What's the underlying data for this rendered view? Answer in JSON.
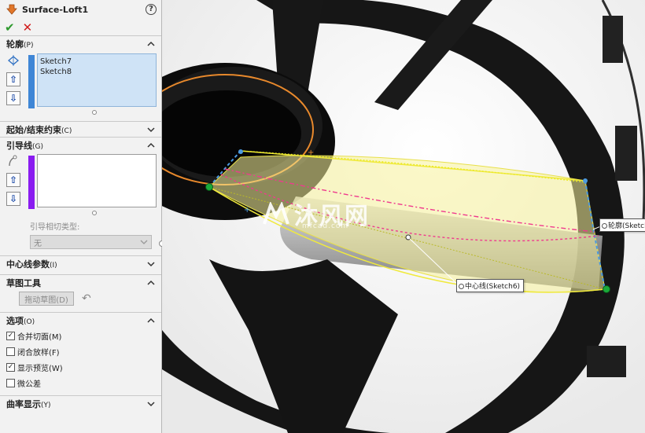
{
  "feature": {
    "title": "Surface-Loft1",
    "help": "?"
  },
  "actions": {
    "ok": "✔",
    "cancel": "✕"
  },
  "sections": {
    "profiles": {
      "title": "轮廓",
      "mnemonic": "(P)",
      "items": [
        "Sketch7",
        "Sketch8"
      ]
    },
    "start_end": {
      "title": "起始/结束约束",
      "mnemonic": "(C)"
    },
    "guides": {
      "title": "引导线",
      "mnemonic": "(G)",
      "items": [],
      "tangency_label": "引导相切类型:",
      "tangency_value": "无"
    },
    "centerline": {
      "title": "中心线参数",
      "mnemonic": "(I)"
    },
    "sketch_tools": {
      "title": "草图工具",
      "drag_button": "拖动草图(D)"
    },
    "options": {
      "title": "选项",
      "mnemonic": "(O)",
      "checks": [
        {
          "label": "合并切面(M)",
          "checked": true
        },
        {
          "label": "闭合放样(F)",
          "checked": false
        },
        {
          "label": "显示预览(W)",
          "checked": true
        },
        {
          "label": "微公差",
          "checked": false
        }
      ]
    },
    "curvature": {
      "title": "曲率显示",
      "mnemonic": "(Y)"
    }
  },
  "viewport": {
    "callout_centerline": "中心线(Sketch6)",
    "callout_profile": "轮廓(Sketch",
    "watermark": "沐风网",
    "watermark_url": "mfcad.com"
  },
  "colors": {
    "profile_bar": "#3f86d6",
    "guide_bar": "#8a1cf0",
    "list_selected": "#cfe3f6",
    "loft_surface": "#f7f29a",
    "model": "#1b1b1b"
  }
}
